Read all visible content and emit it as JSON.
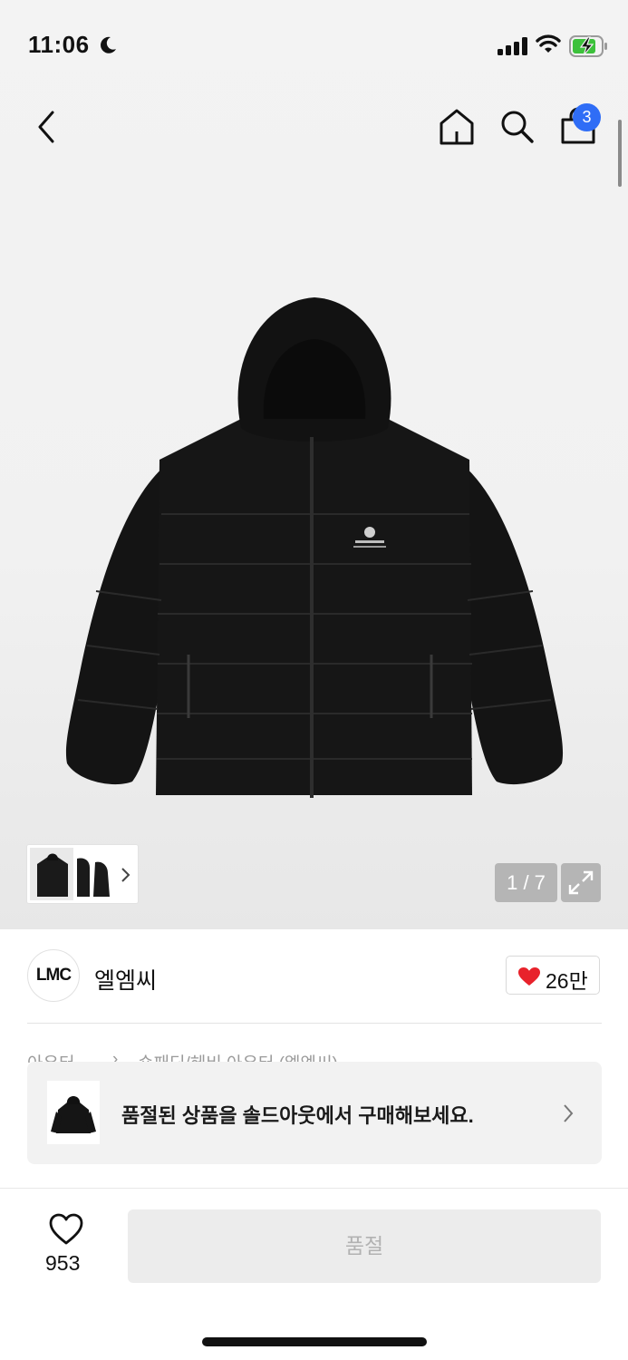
{
  "status_bar": {
    "time": "11:06"
  },
  "nav": {
    "cart_count": "3"
  },
  "gallery": {
    "counter": "1 / 7"
  },
  "brand": {
    "logo_text": "LMC",
    "name": "엘엠씨",
    "likes": "26만"
  },
  "breadcrumb": {
    "items": [
      "아우터",
      "숏패딩/헤비 아우터 (엘엠씨)"
    ]
  },
  "soldout_banner": {
    "message": "품절된 상품을 솔드아웃에서 구매해보세요."
  },
  "bottom": {
    "wish_count": "953",
    "buy_button_label": "품절"
  },
  "colors": {
    "accent_blue": "#2f6df6",
    "like_red": "#e8222b"
  }
}
